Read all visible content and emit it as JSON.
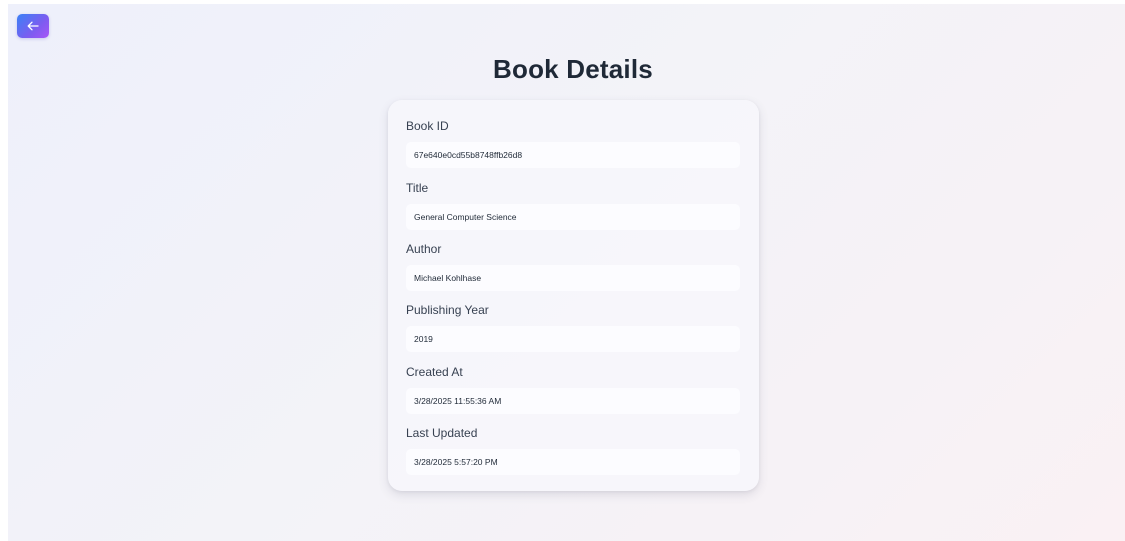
{
  "header": {
    "back_icon": "arrow-left-icon",
    "title": "Book Details"
  },
  "fields": [
    {
      "label": "Book ID",
      "value": "67e640e0cd55b8748ffb26d8"
    },
    {
      "label": "Title",
      "value": "General Computer Science"
    },
    {
      "label": "Author",
      "value": "Michael Kohlhase"
    },
    {
      "label": "Publishing Year",
      "value": "2019"
    },
    {
      "label": "Created At",
      "value": "3/28/2025 11:55:36 AM"
    },
    {
      "label": "Last Updated",
      "value": "3/28/2025 5:57:20 PM"
    }
  ],
  "colors": {
    "accent_gradient_start": "#3b82f6",
    "accent_gradient_end": "#a855f7",
    "title_text": "#1f2937"
  }
}
